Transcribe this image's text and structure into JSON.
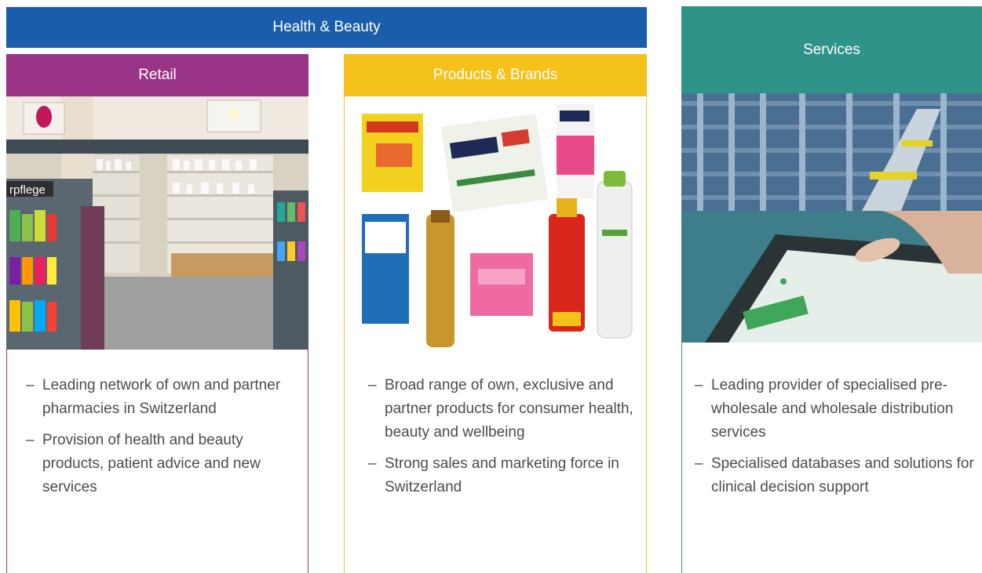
{
  "header": {
    "title": "Health & Beauty"
  },
  "services": {
    "title": "Services",
    "bullets": [
      "Leading provider of specialised pre-wholesale and wholesale distribution services",
      "Specialised databases and solutions for clinical decision support"
    ]
  },
  "retail": {
    "title": "Retail",
    "bullets": [
      "Leading network of own and partner pharmacies in Switzerland",
      "Provision of health and beauty products, patient advice and new services"
    ]
  },
  "products": {
    "title": "Products & Brands",
    "bullets": [
      "Broad range of own, exclusive and partner products for consumer health, beauty and wellbeing",
      "Strong sales and marketing force in Switzerland"
    ]
  },
  "colors": {
    "health_beauty": "#1a5daa",
    "retail": "#993385",
    "products": "#f5c11b",
    "services": "#2e9389"
  }
}
